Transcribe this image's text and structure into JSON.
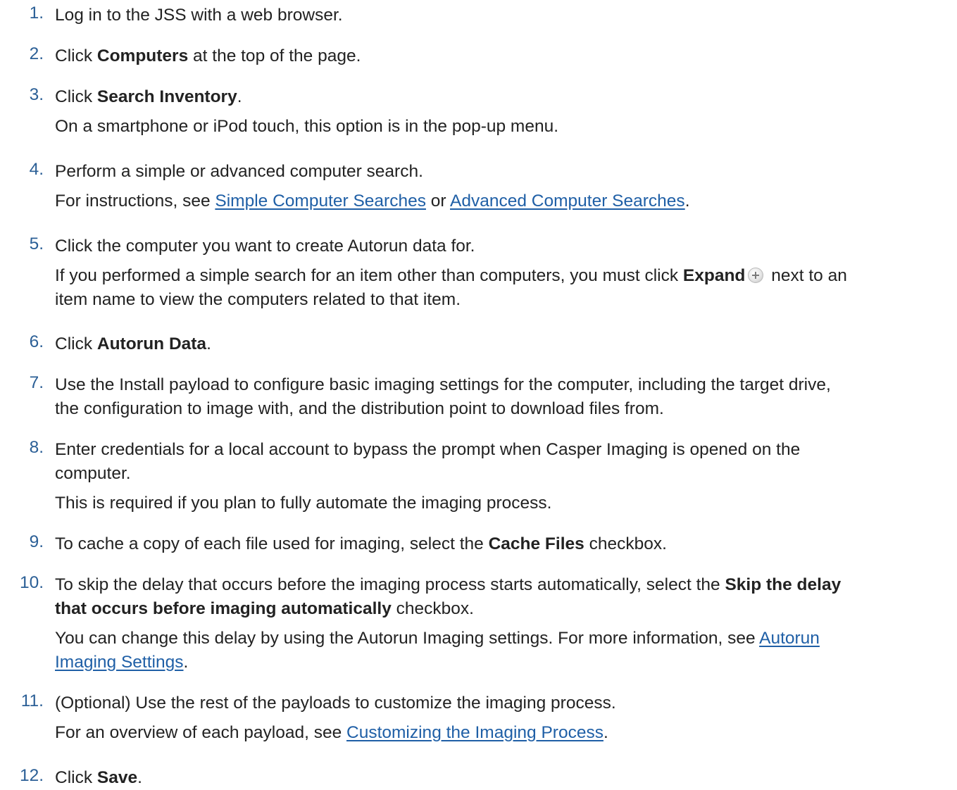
{
  "steps": [
    {
      "number": "1.",
      "text": "Log in to the JSS with a web browser."
    },
    {
      "number": "2.",
      "pre": "Click ",
      "bold": "Computers",
      "post": " at the top of the page."
    },
    {
      "number": "3.",
      "pre": "Click ",
      "bold": "Search Inventory",
      "post": ".",
      "note": "On a smartphone or iPod touch, this option is in the pop-up menu."
    },
    {
      "number": "4.",
      "text": "Perform a simple or advanced computer search.",
      "note_pre": "For instructions, see ",
      "link1": "Simple Computer Searches",
      "note_mid": " or ",
      "link2": "Advanced Computer Searches",
      "note_post": "."
    },
    {
      "number": "5.",
      "text": "Click the computer you want to create Autorun data for.",
      "note_line1_pre": "If you performed a simple search for an item other than computers, you must click ",
      "note_bold": "Expand",
      "icon": "plus-icon",
      "note_line1_post": " next to an",
      "note_line2": "item name to view the computers related to that item."
    },
    {
      "number": "6.",
      "pre": "Click ",
      "bold": "Autorun Data",
      "post": "."
    },
    {
      "number": "7.",
      "line1": "Use the Install payload to configure basic imaging settings for the computer, including the target drive,",
      "line2": "the configuration to image with, and the distribution point to download files from."
    },
    {
      "number": "8.",
      "line1": "Enter credentials for a local account to bypass the prompt when Casper Imaging is opened on the",
      "line2": "computer.",
      "note": "This is required if you plan to fully automate the imaging process."
    },
    {
      "number": "9.",
      "pre": "To cache a copy of each file used for imaging, select the ",
      "bold": "Cache Files",
      "post": " checkbox."
    },
    {
      "number": "10.",
      "line1_pre": "To skip the delay that occurs before the imaging process starts automatically, select the ",
      "line1_bold": "Skip the delay",
      "line2_bold": "that occurs before imaging automatically",
      "line2_post": " checkbox.",
      "note_line1_pre": "You can change this delay by using the Autorun Imaging settings. For more information, see ",
      "link_part1": "Autorun ",
      "link_part2": "Imaging Settings",
      "note_line2_post": "."
    },
    {
      "number": "11.",
      "text": "(Optional) Use the rest of the payloads to customize the imaging process.",
      "note_pre": "For an overview of each payload, see ",
      "link": "Customizing the Imaging Process",
      "note_post": "."
    },
    {
      "number": "12.",
      "pre": "Click ",
      "bold": "Save",
      "post": "."
    }
  ]
}
